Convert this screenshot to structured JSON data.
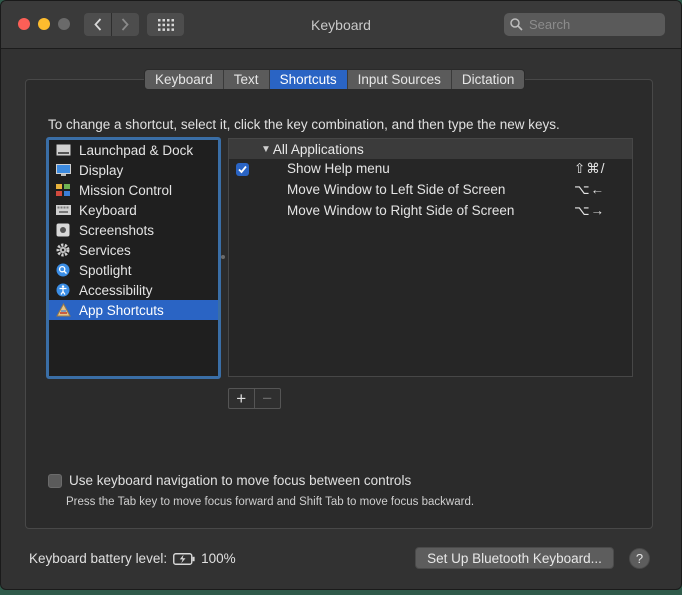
{
  "window": {
    "title": "Keyboard"
  },
  "search": {
    "placeholder": "Search"
  },
  "tabs": [
    {
      "label": "Keyboard",
      "active": false
    },
    {
      "label": "Text",
      "active": false
    },
    {
      "label": "Shortcuts",
      "active": true
    },
    {
      "label": "Input Sources",
      "active": false
    },
    {
      "label": "Dictation",
      "active": false
    }
  ],
  "instructions": "To change a shortcut, select it, click the key combination, and then type the new keys.",
  "categories": [
    {
      "label": "Launchpad & Dock",
      "icon": "launchpad-icon"
    },
    {
      "label": "Display",
      "icon": "display-icon"
    },
    {
      "label": "Mission Control",
      "icon": "mission-control-icon"
    },
    {
      "label": "Keyboard",
      "icon": "keyboard-icon"
    },
    {
      "label": "Screenshots",
      "icon": "screenshot-icon"
    },
    {
      "label": "Services",
      "icon": "gear-icon"
    },
    {
      "label": "Spotlight",
      "icon": "spotlight-icon"
    },
    {
      "label": "Accessibility",
      "icon": "accessibility-icon"
    },
    {
      "label": "App Shortcuts",
      "icon": "app-shortcuts-icon",
      "selected": true
    }
  ],
  "shortcuts": {
    "group": "All Applications",
    "rows": [
      {
        "name": "Show Help menu",
        "keys": "⇧⌘/",
        "checked": true
      },
      {
        "name": "Move Window to Left Side of Screen",
        "keys": "⌥←",
        "checked": false
      },
      {
        "name": "Move Window to Right Side of Screen",
        "keys": "⌥→",
        "checked": false
      }
    ]
  },
  "buttons": {
    "add": "+",
    "remove": "−"
  },
  "keyboard_nav": {
    "label": "Use keyboard navigation to move focus between controls",
    "hint": "Press the Tab key to move focus forward and Shift Tab to move focus backward.",
    "checked": false
  },
  "footer": {
    "battery_label": "Keyboard battery level:",
    "battery_value": "100%",
    "bluetooth_button": "Set Up Bluetooth Keyboard...",
    "help": "?"
  },
  "colors": {
    "accent": "#2a64c4",
    "focus_ring": "#3a6ea6"
  }
}
